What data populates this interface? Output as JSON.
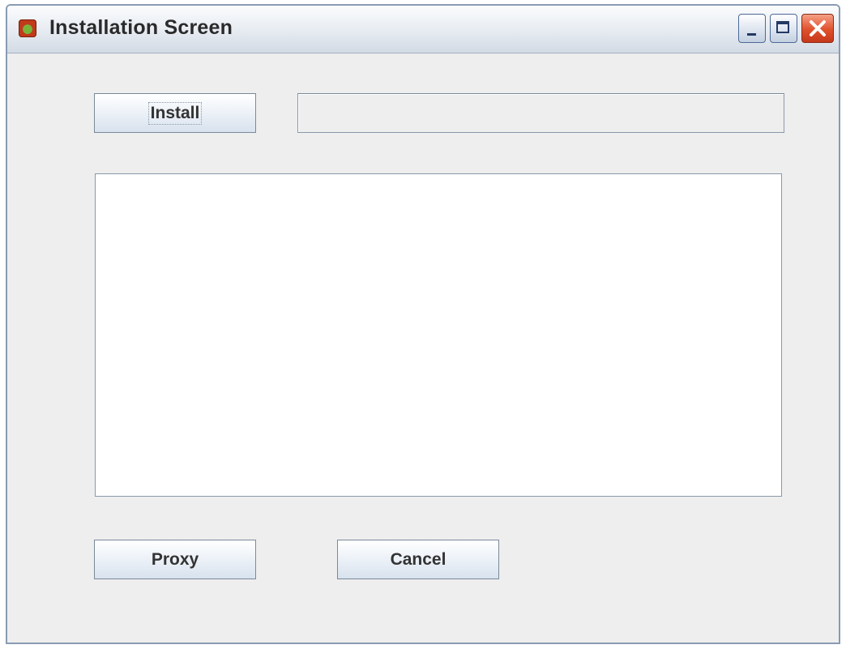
{
  "window": {
    "title": "Installation Screen",
    "icon": "application-icon"
  },
  "title_controls": [
    "minimize-icon",
    "maximize-icon",
    "close-icon"
  ],
  "toolbar": {
    "install_label": "Install",
    "path_value": ""
  },
  "log": {
    "text": ""
  },
  "footer": {
    "proxy_label": "Proxy",
    "cancel_label": "Cancel"
  },
  "colors": {
    "window_background": "#eeeeee",
    "close_button": "#e0502c"
  }
}
